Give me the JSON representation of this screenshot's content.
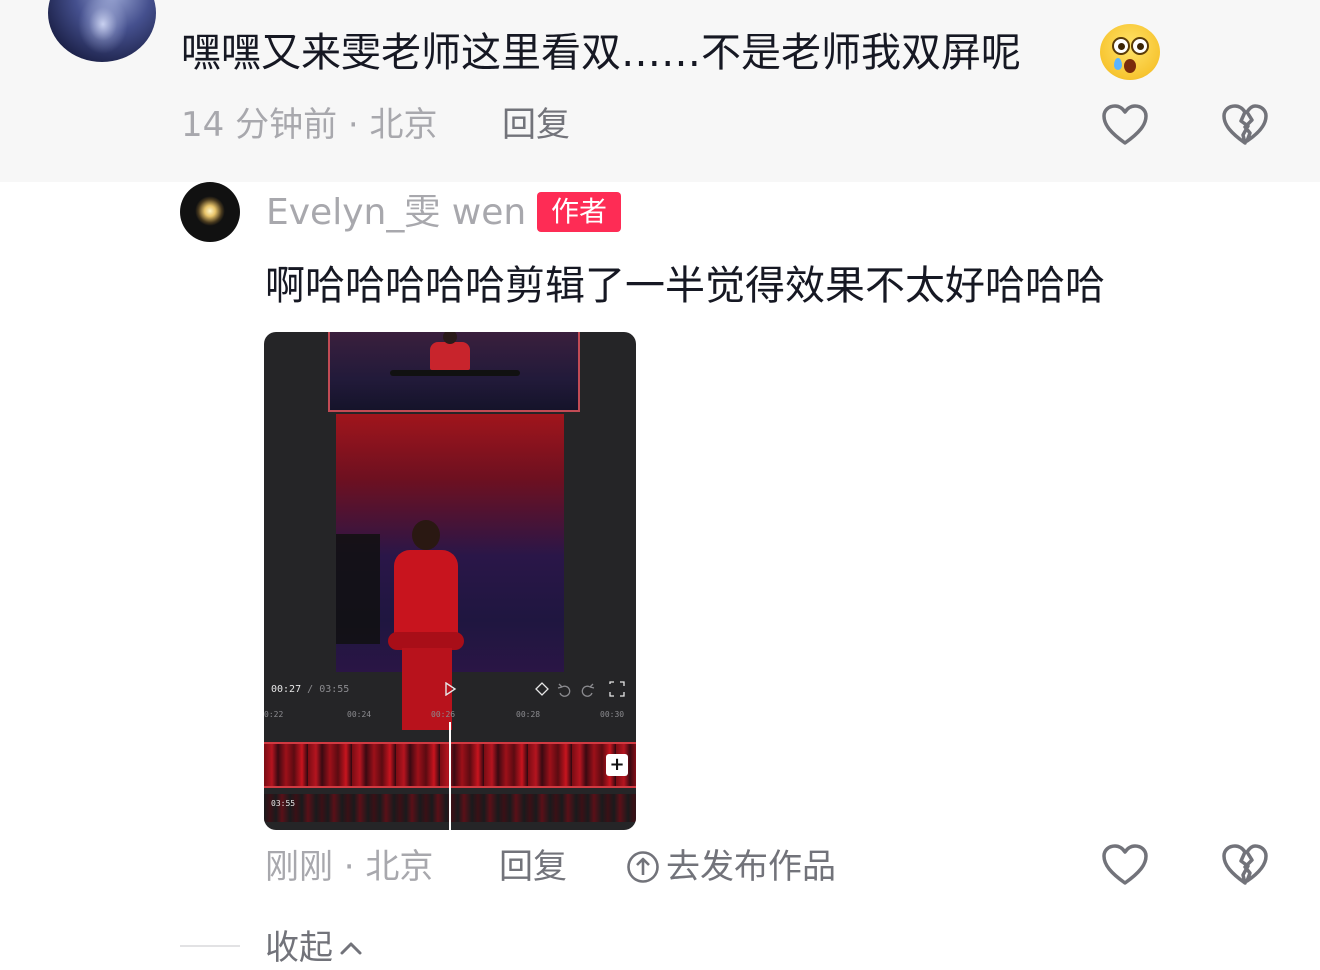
{
  "top_comment": {
    "text": "嘿嘿又来雯老师这里看双……不是老师我双屏呢",
    "emoji": "flushed-emoji",
    "meta": "14 分钟前 · 北京",
    "reply_label": "回复"
  },
  "reply_comment": {
    "username": "Evelyn_雯 wen",
    "badge": "作者",
    "text": "啊哈哈哈哈哈剪辑了一半觉得效果不太好哈哈哈",
    "meta": "刚刚 · 北京",
    "reply_label": "回复",
    "publish_label": "去发布作品"
  },
  "video_editor": {
    "current_time": "00:27",
    "total_time": "03:55",
    "ruler_ticks": [
      "0:22",
      "00:24",
      "00:26",
      "00:28",
      "00:30"
    ],
    "audio_duration": "03:55",
    "add_label": "+"
  },
  "collapse_label": "收起",
  "icons": {
    "like": "heart-outline-icon",
    "dislike": "broken-heart-icon",
    "publish": "upload-circle-icon",
    "collapse": "chevron-up-icon"
  },
  "colors": {
    "badge": "#fe2c55",
    "text": "#161823",
    "secondary": "#a8a8ad",
    "top_block_bg": "#f7f7f7"
  }
}
